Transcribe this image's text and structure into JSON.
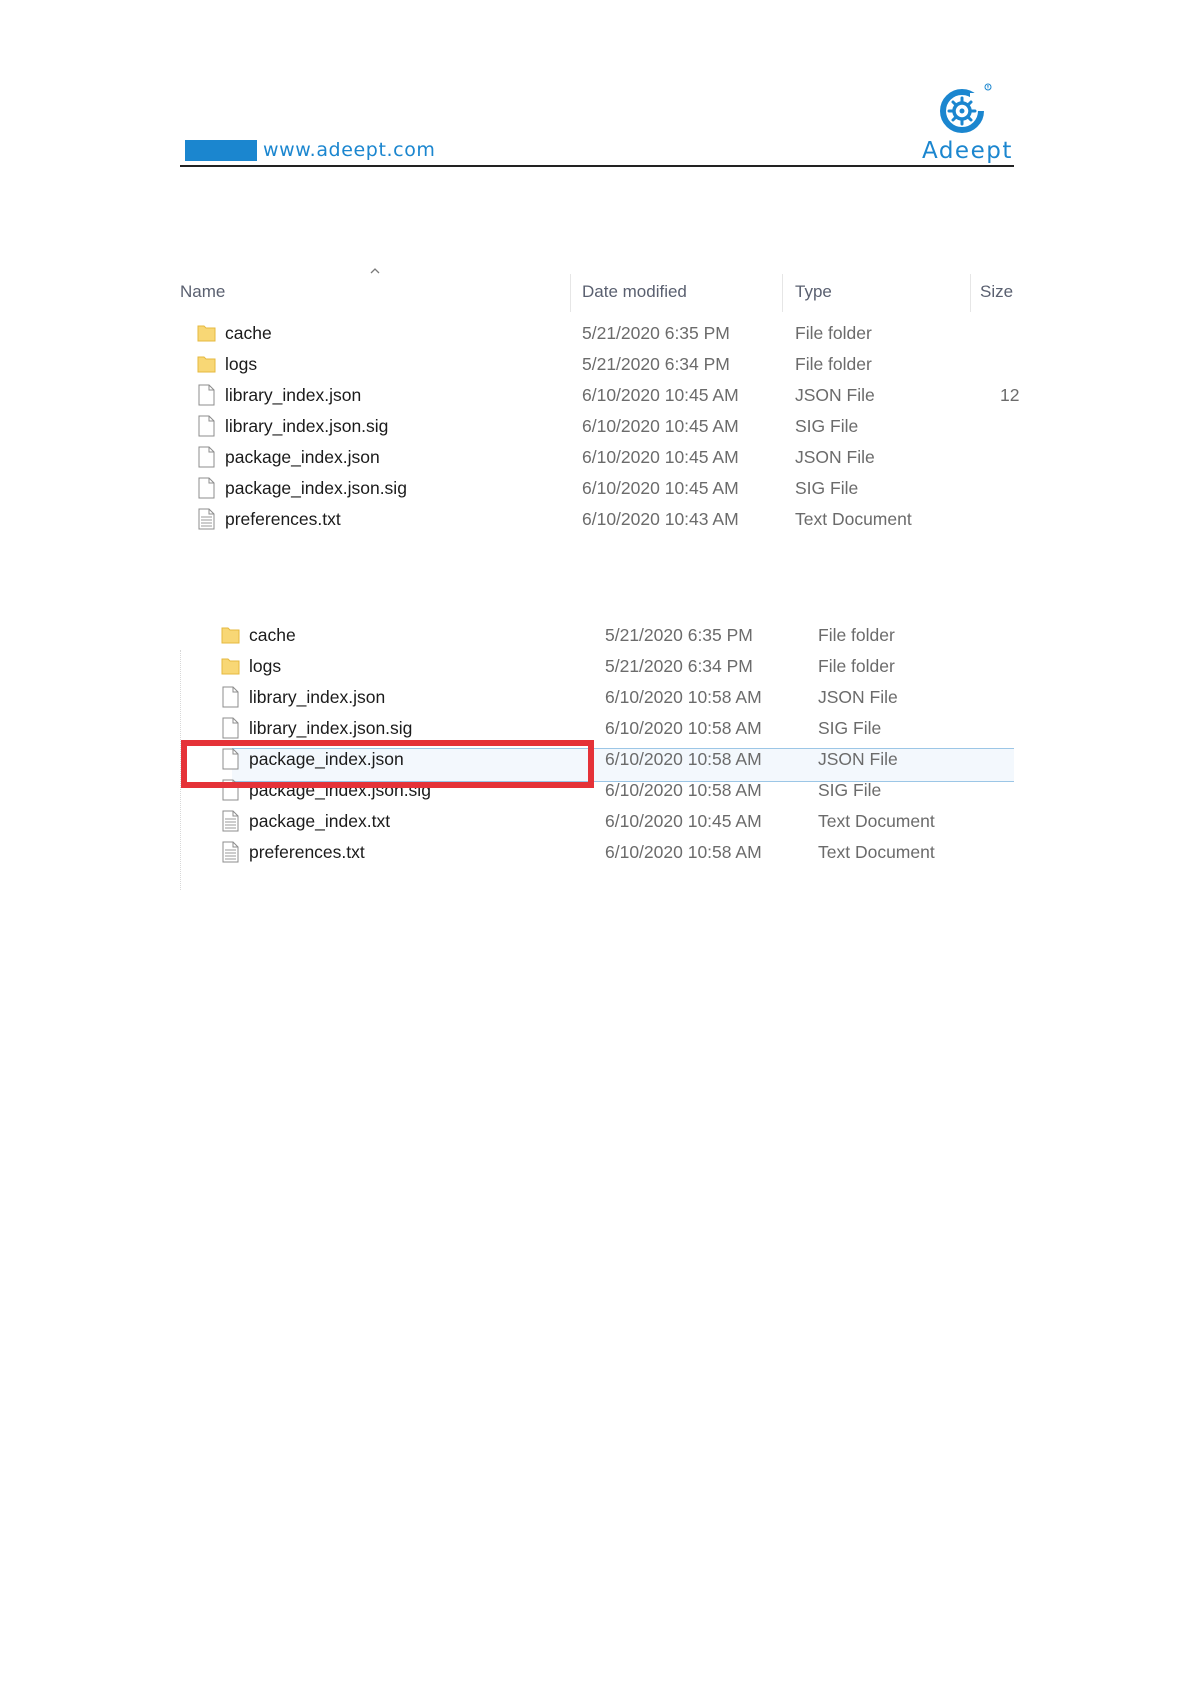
{
  "header": {
    "url": "www.adeept.com",
    "brand": "Adeept",
    "brand_color": "#1b86cf"
  },
  "explorer_before": {
    "columns": [
      "Name",
      "Date modified",
      "Type",
      "Size"
    ],
    "rows": [
      {
        "icon": "folder-icon",
        "name": "cache",
        "date": "5/21/2020 6:35 PM",
        "type": "File folder",
        "size": ""
      },
      {
        "icon": "folder-icon",
        "name": "logs",
        "date": "5/21/2020 6:34 PM",
        "type": "File folder",
        "size": ""
      },
      {
        "icon": "file-icon",
        "name": "library_index.json",
        "date": "6/10/2020 10:45 AM",
        "type": "JSON File",
        "size": "12"
      },
      {
        "icon": "file-icon",
        "name": "library_index.json.sig",
        "date": "6/10/2020 10:45 AM",
        "type": "SIG File",
        "size": ""
      },
      {
        "icon": "file-icon",
        "name": "package_index.json",
        "date": "6/10/2020 10:45 AM",
        "type": "JSON File",
        "size": ""
      },
      {
        "icon": "file-icon",
        "name": "package_index.json.sig",
        "date": "6/10/2020 10:45 AM",
        "type": "SIG File",
        "size": ""
      },
      {
        "icon": "text-file-icon",
        "name": "preferences.txt",
        "date": "6/10/2020 10:43 AM",
        "type": "Text Document",
        "size": ""
      }
    ]
  },
  "explorer_after": {
    "highlighted_row": "package_index.json",
    "highlight_color": "#e53238",
    "rows": [
      {
        "icon": "folder-icon",
        "name": "cache",
        "date": "5/21/2020 6:35 PM",
        "type": "File folder"
      },
      {
        "icon": "folder-icon",
        "name": "logs",
        "date": "5/21/2020 6:34 PM",
        "type": "File folder"
      },
      {
        "icon": "file-icon",
        "name": "library_index.json",
        "date": "6/10/2020 10:58 AM",
        "type": "JSON File"
      },
      {
        "icon": "file-icon",
        "name": "library_index.json.sig",
        "date": "6/10/2020 10:58 AM",
        "type": "SIG File"
      },
      {
        "icon": "file-icon",
        "name": "package_index.json",
        "date": "6/10/2020 10:58 AM",
        "type": "JSON File"
      },
      {
        "icon": "file-icon",
        "name": "package_index.json.sig",
        "date": "6/10/2020 10:58 AM",
        "type": "SIG File"
      },
      {
        "icon": "text-file-icon",
        "name": "package_index.txt",
        "date": "6/10/2020 10:45 AM",
        "type": "Text Document"
      },
      {
        "icon": "text-file-icon",
        "name": "preferences.txt",
        "date": "6/10/2020 10:58 AM",
        "type": "Text Document"
      }
    ]
  }
}
